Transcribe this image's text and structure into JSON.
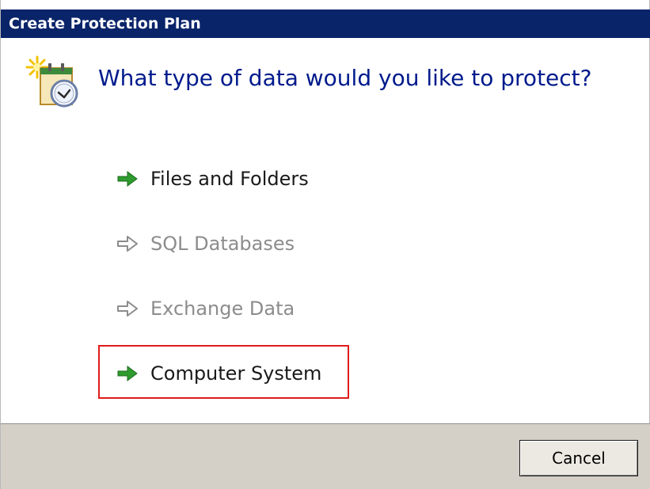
{
  "window": {
    "title": "Create Protection Plan"
  },
  "header": {
    "icon": "protection-plan-icon",
    "question": "What type of data would you like to protect?"
  },
  "options": [
    {
      "label": "Files and Folders",
      "enabled": true,
      "icon": "green-arrow-icon"
    },
    {
      "label": "SQL Databases",
      "enabled": false,
      "icon": "gray-arrow-icon"
    },
    {
      "label": "Exchange Data",
      "enabled": false,
      "icon": "gray-arrow-icon"
    },
    {
      "label": "Computer System",
      "enabled": true,
      "icon": "green-arrow-icon",
      "highlighted": true
    }
  ],
  "footer": {
    "cancel_label": "Cancel"
  },
  "colors": {
    "titlebar": "#0a246a",
    "headline": "#001a8c",
    "enabled_arrow": "#2e9b2e",
    "disabled": "#8c8c8c",
    "highlight_border": "#e01b1b",
    "footer": "#d4d0c8"
  }
}
